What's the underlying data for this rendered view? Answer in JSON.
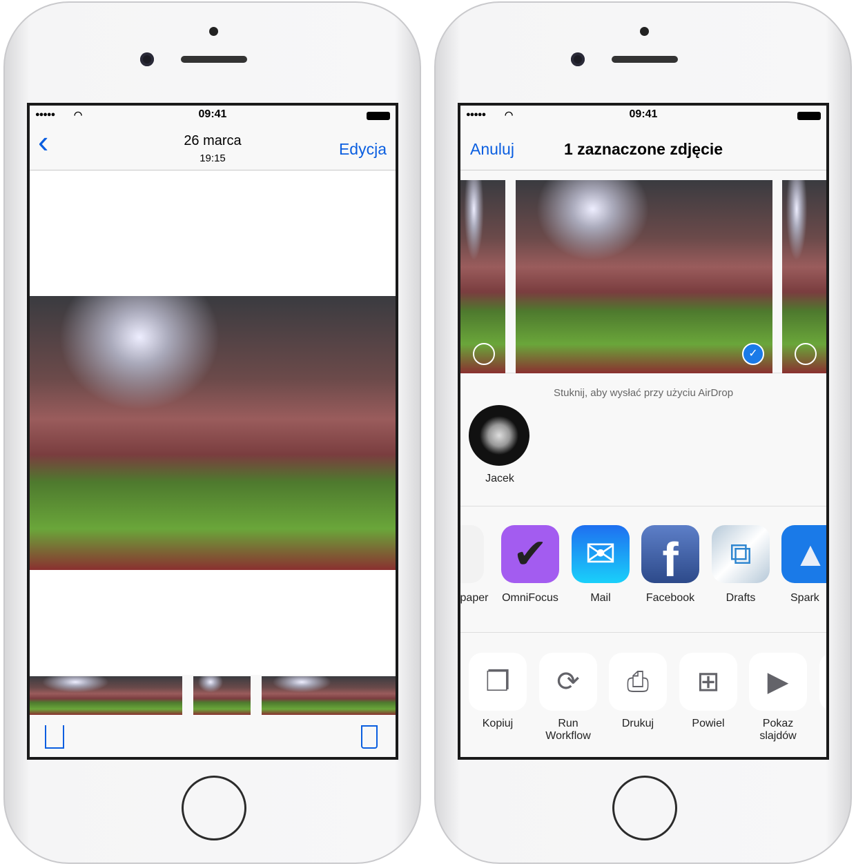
{
  "status": {
    "time": "09:41",
    "signal": "●●●●●",
    "wifi": "wifi-icon"
  },
  "left": {
    "nav": {
      "title": "26 marca",
      "subtitle": "19:15",
      "back": "‹",
      "edit": "Edycja"
    },
    "toolbar": {
      "share": "share-icon",
      "trash": "trash-icon"
    }
  },
  "right": {
    "nav": {
      "cancel": "Anuluj",
      "title": "1 zaznaczone zdjęcie"
    },
    "airdrop_hint": "Stuknij, aby wysłać przy użyciu AirDrop",
    "contact": {
      "name": "Jacek"
    },
    "apps": [
      {
        "label": "paper"
      },
      {
        "label": "OmniFocus",
        "color": "#a35cf0"
      },
      {
        "label": "Mail",
        "color": "#1ea0f8"
      },
      {
        "label": "Facebook",
        "color": "#3b5998"
      },
      {
        "label": "Drafts",
        "color": "#e6eef5"
      },
      {
        "label": "Spark",
        "color": "#1a7ae8"
      }
    ],
    "actions": [
      {
        "label": "Kopiuj",
        "icon": "copy-icon"
      },
      {
        "label": "Run\nWorkflow",
        "icon": "refresh-icon"
      },
      {
        "label": "Drukuj",
        "icon": "print-icon"
      },
      {
        "label": "Powiel",
        "icon": "duplicate-icon"
      },
      {
        "label": "Pokaz\nslajdów",
        "icon": "play-icon"
      }
    ]
  },
  "colors": {
    "accent": "#0a5ee0",
    "check": "#1a7ae8"
  }
}
